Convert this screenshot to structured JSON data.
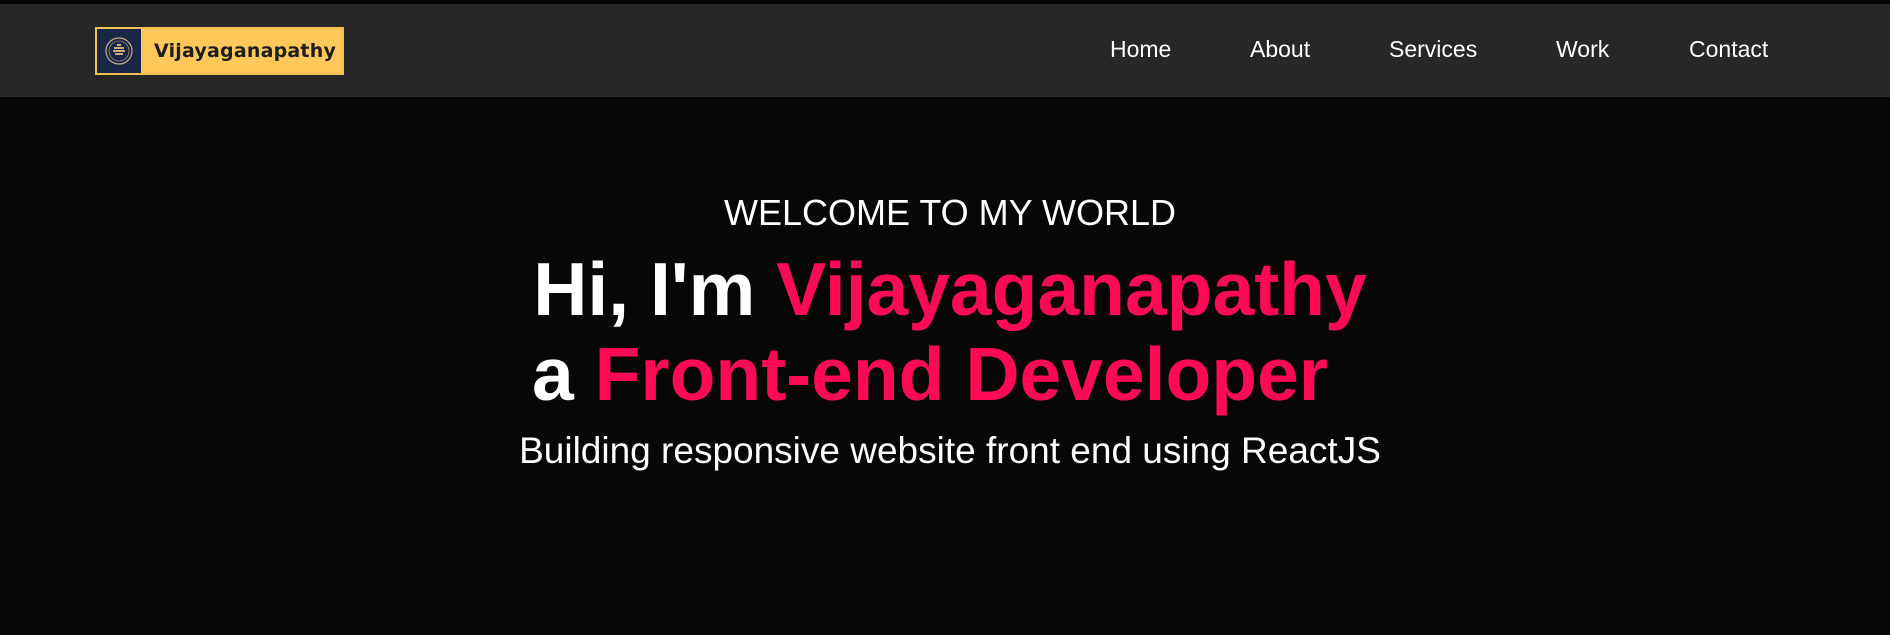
{
  "brand": {
    "name": "Vijayaganapathy",
    "logo_icon": "emblem-icon"
  },
  "nav": {
    "items": [
      {
        "label": "Home"
      },
      {
        "label": "About"
      },
      {
        "label": "Services"
      },
      {
        "label": "Work"
      },
      {
        "label": "Contact"
      }
    ]
  },
  "hero": {
    "eyebrow": "WELCOME TO MY WORLD",
    "line1_prefix": "Hi, I'm",
    "line1_accent": "Vijayaganapathy",
    "line2_prefix": "a",
    "line2_accent": "Front-end Developer",
    "subtitle": "Building responsive website front end using ReactJS"
  },
  "colors": {
    "accent": "#ff0a56",
    "navbar_bg": "#272727",
    "page_bg": "#070707",
    "logo_bg": "#ffc85a",
    "logo_emblem_bg": "#1b2548"
  }
}
